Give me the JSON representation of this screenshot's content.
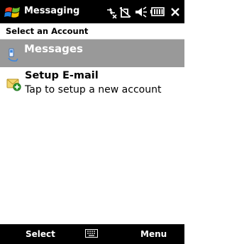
{
  "titlebar": {
    "title": "Messaging",
    "start_icon": "windows-start-icon",
    "status_icons": [
      "data-connection-off-icon",
      "signal-off-icon",
      "volume-icon",
      "battery-icon"
    ],
    "close_label": "×"
  },
  "subheader": {
    "text": "Select an Account"
  },
  "accounts": [
    {
      "label": "Messages",
      "icon": "sms-messages-icon",
      "selected": true
    },
    {
      "label": "Setup E-mail",
      "sublabel": "Tap to setup a new account",
      "icon": "setup-email-icon",
      "selected": false
    }
  ],
  "softkeys": {
    "left": "Select",
    "right": "Menu",
    "center_icon": "keyboard-icon"
  },
  "colors": {
    "bar_bg": "#000000",
    "selected_row_bg": "#999999"
  }
}
